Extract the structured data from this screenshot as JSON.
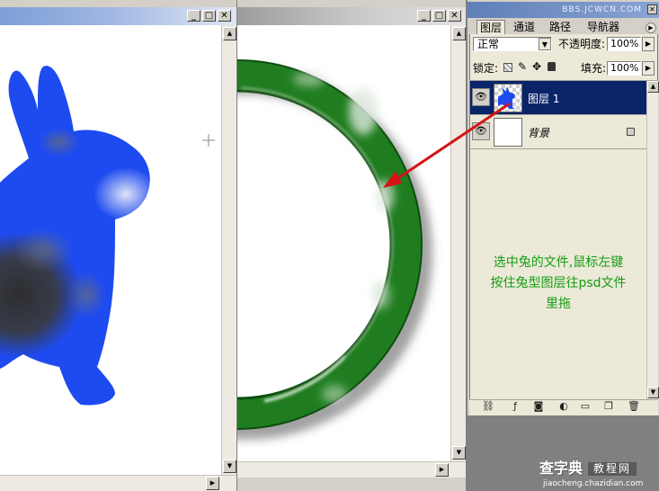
{
  "layers_panel": {
    "header_text": "BBS.JCWCN.COM",
    "tabs": [
      "图层",
      "通道",
      "路径",
      "导航器"
    ],
    "blend_mode": "正常",
    "opacity_label": "不透明度:",
    "opacity_value": "100%",
    "lock_label": "锁定:",
    "fill_label": "填充:",
    "fill_value": "100%",
    "layers": [
      {
        "name": "图层 1",
        "selected": true
      },
      {
        "name": "背景",
        "selected": false,
        "locked": true
      }
    ]
  },
  "annotation": {
    "lines": [
      "选中兔的文件,鼠标左键",
      "按住兔型图层往psd文件",
      "里拖"
    ],
    "color": "#149d14"
  },
  "watermark": {
    "main": "查字典",
    "sub": "教程网",
    "url": "jiaocheng.chazidian.com"
  },
  "colors": {
    "rabbit": "#1e4bf0",
    "ring": "#1f7d1f",
    "arrow": "#d41414",
    "selected_layer": "#0a246a"
  }
}
